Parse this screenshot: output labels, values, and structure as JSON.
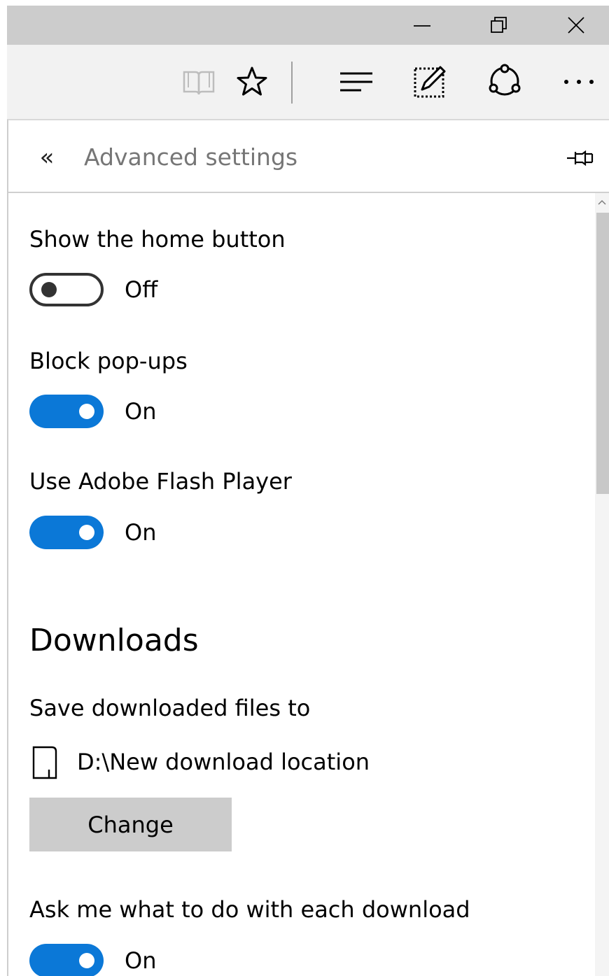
{
  "window": {
    "minimize_icon": "minimize-icon",
    "maximize_icon": "restore-icon",
    "close_icon": "close-icon"
  },
  "toolbar": {
    "reading_view_icon": "book-icon",
    "favorites_icon": "star-icon",
    "hub_icon": "hub-lines-icon",
    "web_note_icon": "pen-note-icon",
    "share_icon": "share-icon",
    "more_icon": "ellipsis-icon"
  },
  "panel": {
    "back_glyph": "«",
    "title": "Advanced settings",
    "pin_icon": "pin-icon"
  },
  "settings": [
    {
      "label": "Show the home button",
      "state": "Off",
      "on": false
    },
    {
      "label": "Block pop-ups",
      "state": "On",
      "on": true
    },
    {
      "label": "Use Adobe Flash Player",
      "state": "On",
      "on": true
    }
  ],
  "downloads": {
    "heading": "Downloads",
    "save_label": "Save downloaded files to",
    "path": "D:\\New download location",
    "change_button": "Change",
    "ask_label": "Ask me what to do with each download",
    "ask_state": "On",
    "ask_on": true
  },
  "colors": {
    "accent": "#0b78d7",
    "titlebar": "#cccccc",
    "toolbar": "#f2f2f2",
    "button": "#cccccc"
  }
}
